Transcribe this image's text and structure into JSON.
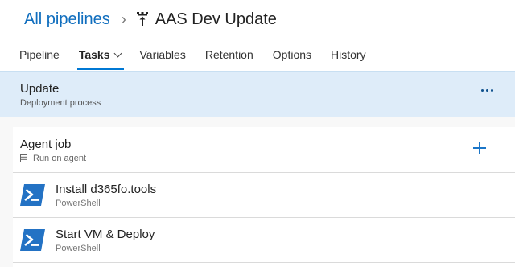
{
  "breadcrumb": {
    "root": "All pipelines",
    "separator": "›",
    "pipeline_icon": "pipeline-release-icon",
    "pipeline_name": "AAS Dev Update"
  },
  "tabs": [
    {
      "label": "Pipeline",
      "active": false
    },
    {
      "label": "Tasks",
      "active": true,
      "has_dropdown": true
    },
    {
      "label": "Variables",
      "active": false
    },
    {
      "label": "Retention",
      "active": false
    },
    {
      "label": "Options",
      "active": false
    },
    {
      "label": "History",
      "active": false
    }
  ],
  "stage": {
    "title": "Update",
    "subtitle": "Deployment process",
    "more_icon": "more-actions-icon"
  },
  "agent_job": {
    "title": "Agent job",
    "subtitle": "Run on agent",
    "icon": "server-icon",
    "add_icon": "add-task-icon"
  },
  "tasks": [
    {
      "title": "Install d365fo.tools",
      "type": "PowerShell",
      "icon": "powershell-icon"
    },
    {
      "title": "Start VM & Deploy",
      "type": "PowerShell",
      "icon": "powershell-icon"
    }
  ],
  "colors": {
    "accent": "#0078d4",
    "selected_bg": "#deecf9",
    "powershell": "#2372c4"
  }
}
